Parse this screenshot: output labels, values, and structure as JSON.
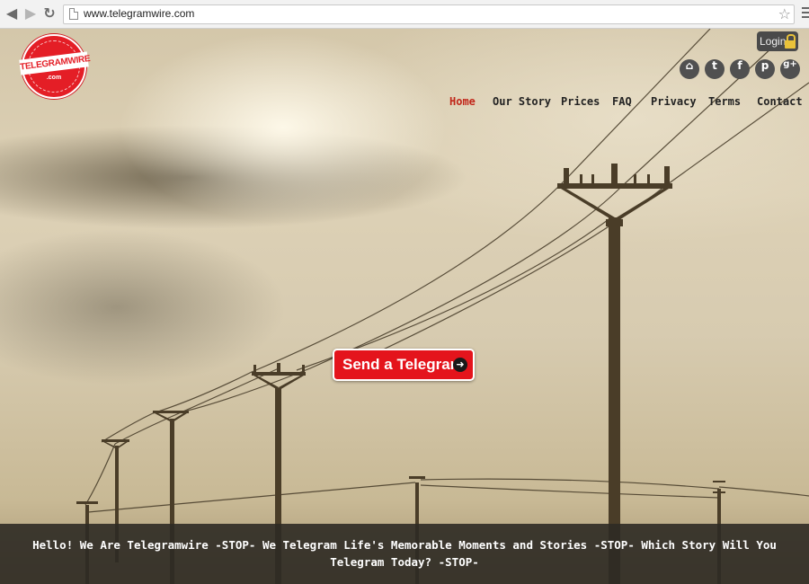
{
  "browser": {
    "url": "www.telegramwire.com",
    "back_icon": "◀",
    "forward_icon": "▶",
    "reload_icon": "↻",
    "bookmark_icon": "☆"
  },
  "logo": {
    "banner_text": "TELEGRAMWIRE",
    "sub_text": ".com"
  },
  "login": {
    "label": "Login"
  },
  "social": [
    {
      "name": "home-icon",
      "glyph": "⌂"
    },
    {
      "name": "twitter-icon",
      "glyph": "t"
    },
    {
      "name": "facebook-icon",
      "glyph": "f"
    },
    {
      "name": "pinterest-icon",
      "glyph": "p"
    },
    {
      "name": "google-plus-icon",
      "glyph": "g+"
    }
  ],
  "nav": {
    "items": [
      {
        "label": "Home",
        "active": true
      },
      {
        "label": "Our Story"
      },
      {
        "label": "Prices"
      },
      {
        "label": "FAQ"
      },
      {
        "label": "Privacy"
      },
      {
        "label": "Terms"
      },
      {
        "label": "Contact"
      }
    ]
  },
  "cta": {
    "label": "Send a Telegram",
    "arrow_icon": "➜"
  },
  "tagline": "Hello! We Are Telegramwire -STOP- We Telegram Life's Memorable Moments and Stories -STOP- Which Story Will You Telegram Today? -STOP-",
  "colors": {
    "brand_red": "#e41e26",
    "active_nav": "#c1271a"
  }
}
